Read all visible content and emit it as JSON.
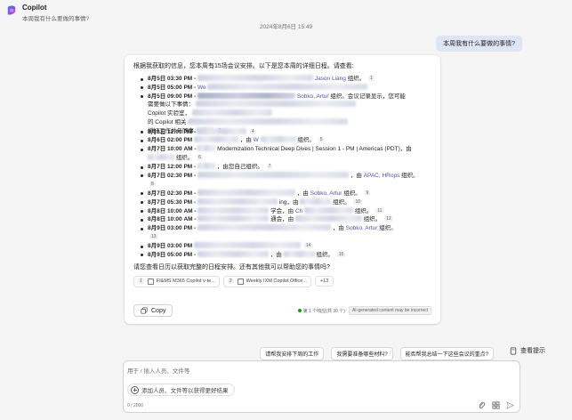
{
  "header": {
    "app_title": "Copilot",
    "subtitle": "本周我有什么要做的事情?"
  },
  "timestamp": "2024年8月6日 15:49",
  "user_message": "本周我有什么要做的事情?",
  "answer": {
    "intro": "根据我获取的信息，您本周有15场会议安排。以下是您本周的详细日程。请查看:",
    "events": [
      {
        "time": "8月5日 03:30 PM -",
        "parts": [
          "由",
          "Jason Liang",
          "组织。"
        ],
        "cite": "1"
      },
      {
        "time": "8月5日 05:00 PM -",
        "parts": [
          "We"
        ],
        "cite": ""
      },
      {
        "time": "8月5日 09:00 PM -",
        "parts": [
          "由",
          "Sobko, Artur",
          "组织。会议记录显示，您可能需要做以下事情：...完成任务...查看...的内容...Copilot 实验室...的 Copilot 相关...在 ... 中...安排好工作并与同事..."
        ],
        "cite": "2"
      },
      {
        "time": "8月6日 12:00 PM -",
        "parts": [
          ""
        ],
        "cite": "4"
      },
      {
        "time": "8月6日 02:00 PM",
        "parts": [
          "，由",
          "W",
          "组织。"
        ],
        "cite": "5"
      },
      {
        "time": "8月7日 10:00 AM -",
        "parts": [
          "Modernization Technical Deep Dives | Session 1 - PM | Americas (PDT)，由",
          "组织。"
        ],
        "cite": "6"
      },
      {
        "time": "8月7日 12:00 PM -",
        "parts": [
          "，由您自己组织。"
        ],
        "cite": "7"
      },
      {
        "time": "8月7日 02:30 PM -",
        "parts": [
          "，由",
          "APAC, HRops",
          "组织。"
        ],
        "cite": "8"
      },
      {
        "time": "8月7日 02:30 PM -",
        "parts": [
          "，由",
          "Sobko, Artur",
          "组织。"
        ],
        "cite": "9"
      },
      {
        "time": "8月7日 05:30 PM -",
        "parts": [
          "ing，由",
          "组织。"
        ],
        "cite": "10"
      },
      {
        "time": "8月8日 10:00 AM -",
        "parts": [
          "学会，由",
          "Ch",
          "组织。"
        ],
        "cite": "11"
      },
      {
        "time": "8月8日 10:00 AM -",
        "parts": [
          "通会，由",
          "组织。"
        ],
        "cite": "12"
      },
      {
        "time": "8月9日 03:00 PM -",
        "parts": [
          "，由",
          "Sobko, Artur",
          "组织。"
        ],
        "cite": "13"
      },
      {
        "time": "8月9日 03:00 PM",
        "parts": [
          ""
        ],
        "cite": "14"
      },
      {
        "time": "8月9日 05:00 PM -",
        "parts": [
          "，由",
          "组织。"
        ],
        "cite": "15"
      }
    ],
    "outro": "请您查看日历以获取完整的日程安排。还有其他我可以帮助您的事情吗?",
    "references": [
      {
        "num": "1",
        "label": "FI&MS M365 Copilot v-te..."
      },
      {
        "num": "2",
        "label": "Weekly IXM Copilot Office..."
      }
    ],
    "more_refs": "+13",
    "copy_label": "Copy",
    "response_count": "第 1 个响应(共 30 个)",
    "ai_disclaimer": "AI-generated content may be incorrect"
  },
  "suggestions": [
    "请帮我安排下周的工作",
    "我需要准备哪些材料?",
    "能否帮我总结一下这些会议的重点?"
  ],
  "view_prompts": "查看提示",
  "composer": {
    "placeholder": "用于 / 插入人员、文件等",
    "add_context": "添加人员、文件等以获得更好结果",
    "char_count": "0 / 2000"
  },
  "colors": {
    "accent": "#4f52b2",
    "user_bubble": "#e0e5f6",
    "background": "#f5f5f5"
  },
  "icons": [
    "copilot-logo-icon",
    "copy-icon",
    "document-icon",
    "prompt-book-icon",
    "plus-circle-icon",
    "attach-icon",
    "grid-icon",
    "send-icon"
  ]
}
